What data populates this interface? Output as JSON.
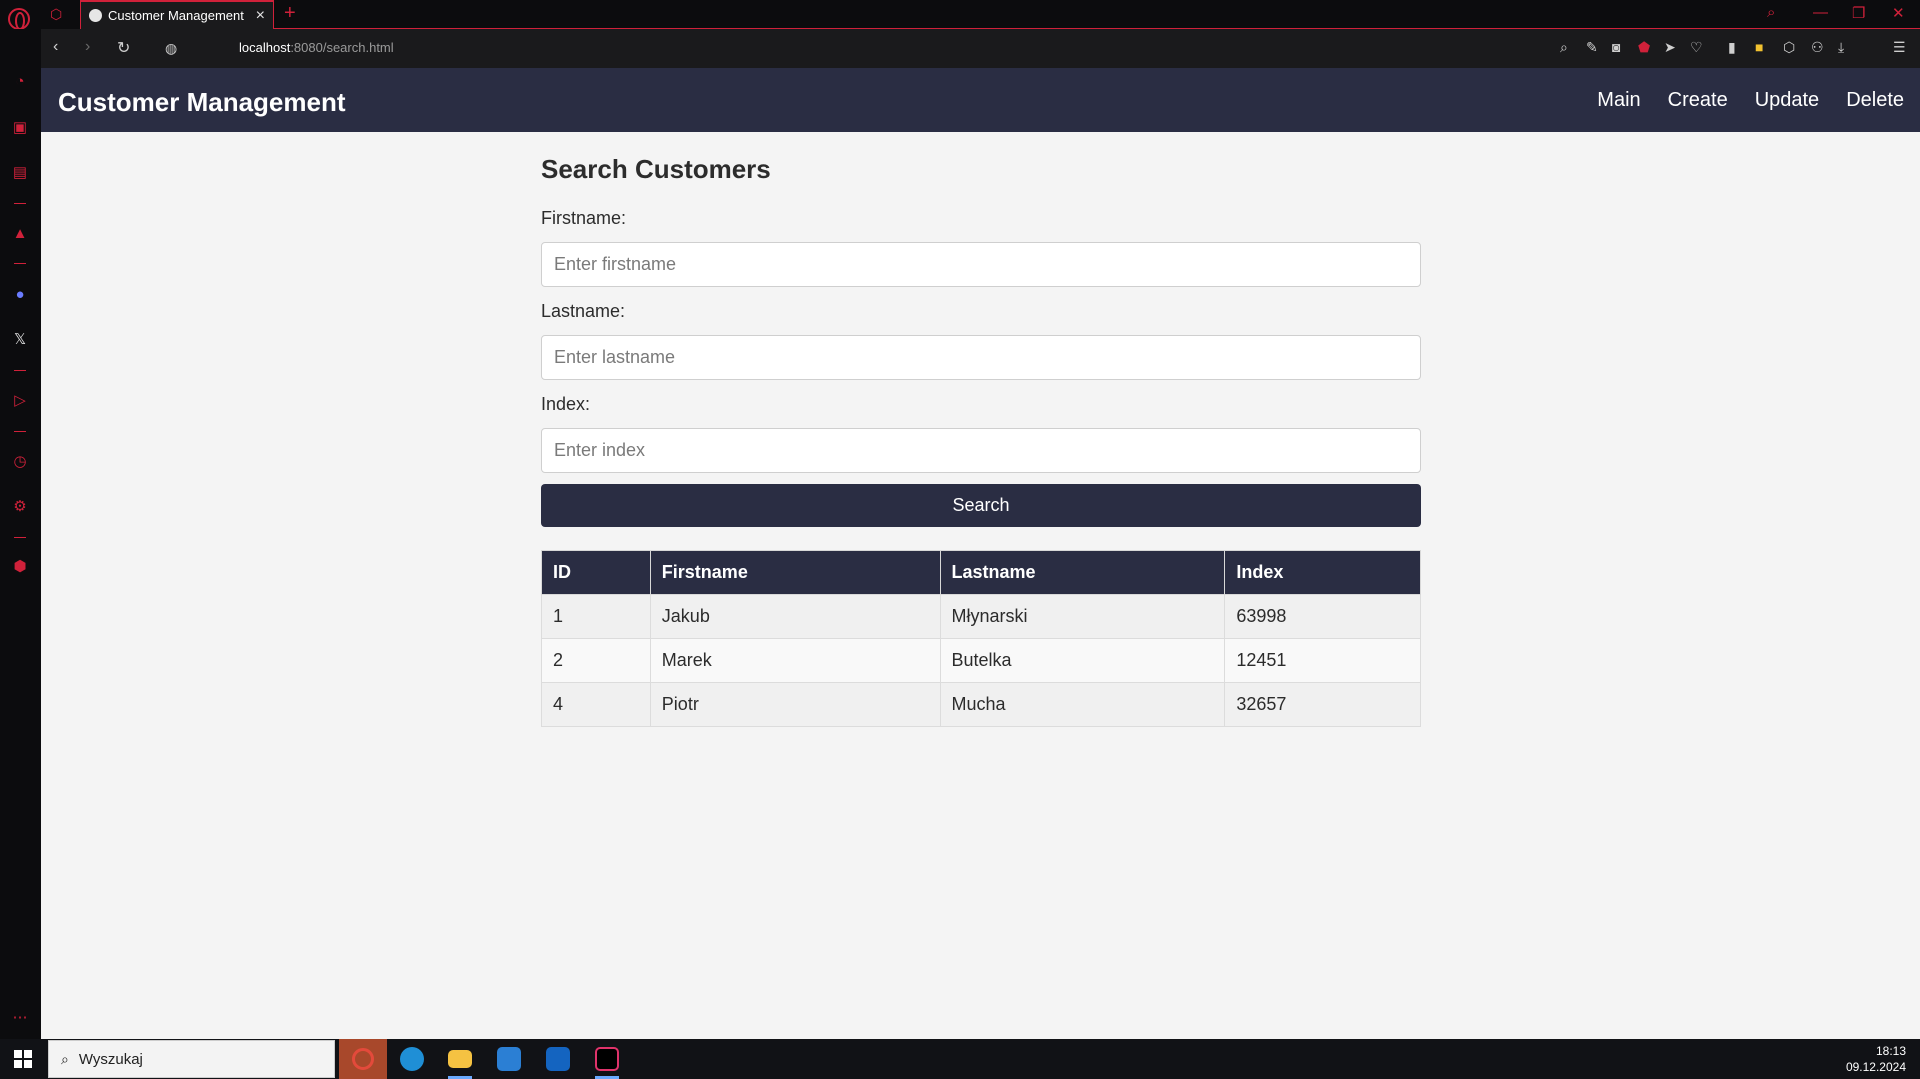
{
  "browser": {
    "tab_title": "Customer Management",
    "address_host": "localhost",
    "address_path": ":8080/search.html"
  },
  "app": {
    "title": "Customer Management",
    "nav": [
      "Main",
      "Create",
      "Update",
      "Delete"
    ]
  },
  "search": {
    "heading": "Search Customers",
    "firstname_label": "Firstname:",
    "firstname_placeholder": "Enter firstname",
    "lastname_label": "Lastname:",
    "lastname_placeholder": "Enter lastname",
    "index_label": "Index:",
    "index_placeholder": "Enter index",
    "button_label": "Search"
  },
  "results": {
    "columns": [
      "ID",
      "Firstname",
      "Lastname",
      "Index"
    ],
    "rows": [
      [
        "1",
        "Jakub",
        "Młynarski",
        "63998"
      ],
      [
        "2",
        "Marek",
        "Butelka",
        "12451"
      ],
      [
        "4",
        "Piotr",
        "Mucha",
        "32657"
      ]
    ]
  },
  "taskbar": {
    "search_text": "Wyszukaj",
    "time": "18:13",
    "date": "09.12.2024"
  },
  "colors": {
    "header_bg": "#2a2d43",
    "browser_accent": "#d0213a",
    "page_bg": "#f4f4f4"
  }
}
